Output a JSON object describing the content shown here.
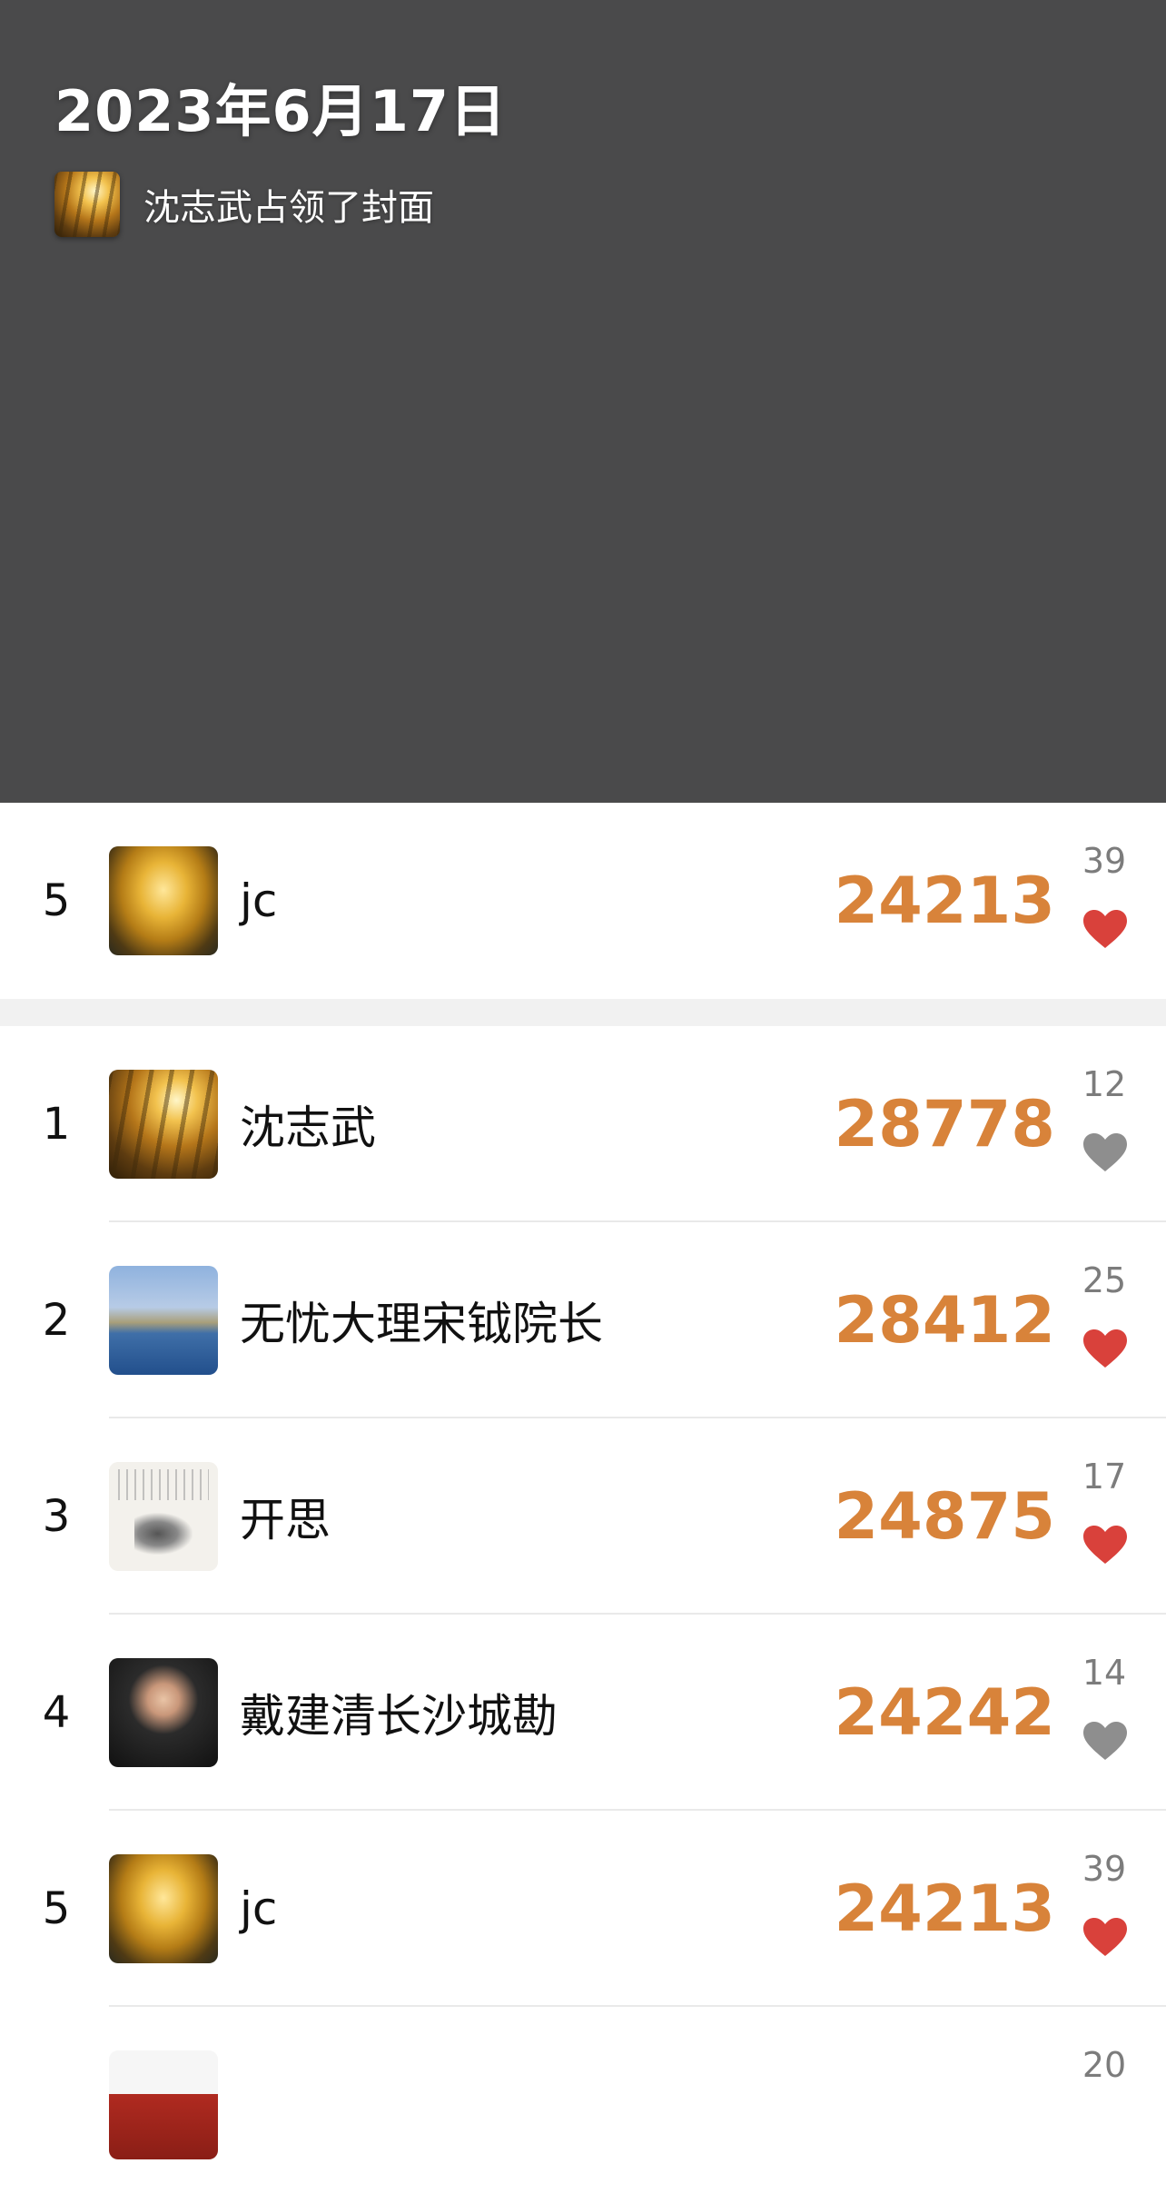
{
  "cover": {
    "date": "2023年6月17日",
    "owner_text": "沈志武占领了封面"
  },
  "my_entry": {
    "rank": "5",
    "name": "jc",
    "steps": "24213",
    "likes": "39",
    "liked": true
  },
  "ranking": [
    {
      "rank": "1",
      "name": "沈志武",
      "steps": "28778",
      "likes": "12",
      "liked": false
    },
    {
      "rank": "2",
      "name": "无忧大理宋钺院长",
      "steps": "28412",
      "likes": "25",
      "liked": true
    },
    {
      "rank": "3",
      "name": "开思",
      "steps": "24875",
      "likes": "17",
      "liked": true
    },
    {
      "rank": "4",
      "name": "戴建清长沙城勘",
      "steps": "24242",
      "likes": "14",
      "liked": false
    },
    {
      "rank": "5",
      "name": "jc",
      "steps": "24213",
      "likes": "39",
      "liked": true
    },
    {
      "rank": "",
      "name": "",
      "steps": "",
      "likes": "20",
      "liked": false
    }
  ],
  "colors": {
    "cover_bg": "#4a4a4b",
    "steps": "#d8833a",
    "heart_liked": "#d9413b",
    "heart_unliked": "#8e8e8e",
    "divider": "#f1f1f1"
  },
  "icons": {
    "like": "heart-icon"
  }
}
